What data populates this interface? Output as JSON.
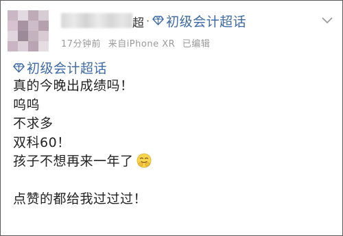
{
  "header": {
    "name_suffix": "超",
    "separator": "·",
    "topic": "初级会计超话",
    "timestamp": "17分钟前",
    "source": "来自iPhone XR",
    "edited": "已编辑"
  },
  "post": {
    "topic": "初级会计超话",
    "lines": [
      "真的今晚出成绩吗！",
      "呜呜",
      "不求多",
      "双科60！",
      "孩子不想再来一年了"
    ],
    "closing": "点赞的都给我过过过！"
  },
  "icons": {
    "topic": "super-topic-gem-icon",
    "menu": "chevron-down-icon",
    "emoji": "pray-smile-emoji"
  },
  "colors": {
    "link": "#3d6aa7",
    "text": "#222222",
    "meta": "#9a9a9a"
  }
}
